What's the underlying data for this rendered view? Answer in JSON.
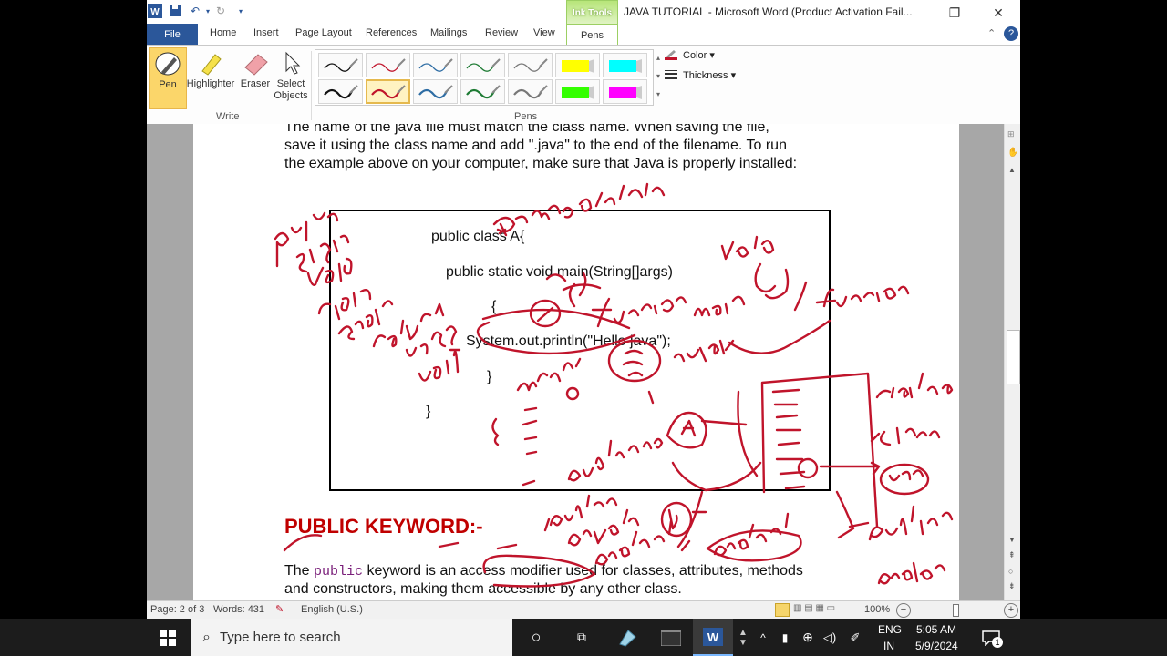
{
  "window": {
    "title": "JAVA TUTORIAL  -  Microsoft Word (Product Activation Fail..."
  },
  "ribbon": {
    "contextual_header": "Ink Tools",
    "tabs": [
      "File",
      "Home",
      "Insert",
      "Page Layout",
      "References",
      "Mailings",
      "Review",
      "View",
      "Pens"
    ],
    "active_tab": "Pens",
    "write_group": {
      "label": "Write",
      "tools": [
        "Pen",
        "Highlighter",
        "Eraser",
        "Select Objects"
      ],
      "selected": "Pen"
    },
    "pens_group": {
      "label": "Pens",
      "pen_colors_row1": [
        "#111111",
        "#c0142b",
        "#2e6da4",
        "#1e7b34",
        "#777777",
        "#ffff00",
        "#00ffff"
      ],
      "pen_colors_row2": [
        "#111111",
        "#c0142b",
        "#2e6da4",
        "#1e7b34",
        "#777777",
        "#33ff00",
        "#ff00ff"
      ],
      "color_label": "Color",
      "thickness_label": "Thickness"
    }
  },
  "document": {
    "intro_lines": [
      "The name of the java file must match the class name. When saving the file,",
      "save it using the class name and add \".java\" to the end of the filename. To run",
      "the example above on your computer, make sure that Java is properly installed:"
    ],
    "code_lines": [
      "public class A{",
      "public static void main(String[]args)",
      "{",
      "System.out.println(\"Hello java\");",
      "}",
      "}"
    ],
    "heading": "PUBLIC KEYWORD:-",
    "para_prefix": "The ",
    "para_keyword": "public",
    "para_rest": " keyword is an access modifier used for classes, attributes, methods",
    "para_line2": "and constructors, making them accessible by any other class."
  },
  "statusbar": {
    "page": "Page: 2 of 3",
    "words": "Words: 431",
    "language": "English (U.S.)",
    "zoom": "100%"
  },
  "taskbar": {
    "search_placeholder": "Type here to search",
    "language": "ENG",
    "region": "IN",
    "time": "5:05 AM",
    "date": "5/9/2024",
    "notification_count": "1"
  },
  "ink_annotations": [
    "public",
    "static",
    "void",
    "class",
    "object",
    "Name of class",
    "void",
    "return type",
    "void",
    "function",
    "main",
    "function",
    "output",
    "work",
    "Private",
    "class",
    "user",
    "public class A",
    "public",
    "private",
    "protected",
    "public",
    "protected",
    "protected"
  ],
  "colors": {
    "accent": "#2b579a",
    "ink": "#c0142b",
    "heading": "#c00000",
    "ink_tools": "#9ccf63"
  }
}
